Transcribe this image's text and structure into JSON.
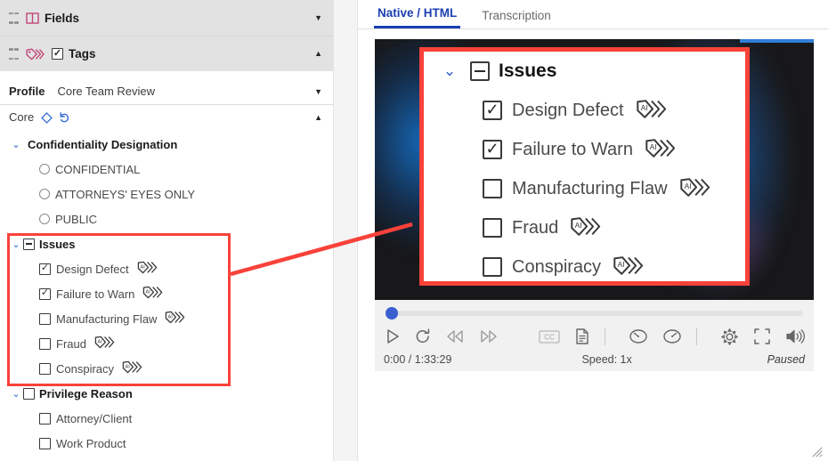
{
  "sidebar": {
    "panels": [
      {
        "label": "Fields",
        "icon": "columns-icon",
        "caret": "▼",
        "expanded": false
      },
      {
        "label": "Tags",
        "icon": "tags-icon",
        "caret": "▲",
        "expanded": true
      }
    ],
    "profile": {
      "label": "Profile",
      "value": "Core Team Review",
      "caret": "▼"
    },
    "core": {
      "label": "Core",
      "caret": "▲",
      "icons": [
        "eraser-icon",
        "undo-icon"
      ]
    },
    "tree": [
      {
        "label": "Confidentiality Designation",
        "type": "node",
        "control": "none",
        "twisty": "⌄"
      },
      {
        "label": "CONFIDENTIAL",
        "type": "leaf",
        "control": "radio",
        "checked": false
      },
      {
        "label": "ATTORNEYS' EYES ONLY",
        "type": "leaf",
        "control": "radio",
        "checked": false
      },
      {
        "label": "PUBLIC",
        "type": "leaf",
        "control": "radio",
        "checked": false
      },
      {
        "label": "Issues",
        "type": "node",
        "control": "minus",
        "twisty": "⌄"
      },
      {
        "label": "Design Defect",
        "type": "leaf",
        "control": "checkbox",
        "checked": true,
        "tag": "ai-tag-icon"
      },
      {
        "label": "Failure to Warn",
        "type": "leaf",
        "control": "checkbox",
        "checked": true,
        "tag": "ai-tag-icon"
      },
      {
        "label": "Manufacturing Flaw",
        "type": "leaf",
        "control": "checkbox",
        "checked": false,
        "tag": "ai-tag-icon"
      },
      {
        "label": "Fraud",
        "type": "leaf",
        "control": "checkbox",
        "checked": false,
        "tag": "ai-tag-icon"
      },
      {
        "label": "Conspiracy",
        "type": "leaf",
        "control": "checkbox",
        "checked": false,
        "tag": "ai-tag-icon"
      },
      {
        "label": "Privilege Reason",
        "type": "node",
        "control": "checkbox",
        "checked": false,
        "twisty": "⌄"
      },
      {
        "label": "Attorney/Client",
        "type": "leaf",
        "control": "checkbox",
        "checked": false
      },
      {
        "label": "Work Product",
        "type": "leaf",
        "control": "checkbox",
        "checked": false
      }
    ]
  },
  "right": {
    "tabs": [
      {
        "label": "Native / HTML",
        "active": true
      },
      {
        "label": "Transcription",
        "active": false
      }
    ],
    "callout": {
      "rows": [
        {
          "label": "Issues",
          "type": "node",
          "control": "minus",
          "twisty": "⌄"
        },
        {
          "label": "Design Defect",
          "type": "leaf",
          "control": "checkbox",
          "checked": true,
          "tag": "ai-tag-icon"
        },
        {
          "label": "Failure to Warn",
          "type": "leaf",
          "control": "checkbox",
          "checked": true,
          "tag": "ai-tag-icon"
        },
        {
          "label": "Manufacturing Flaw",
          "type": "leaf",
          "control": "checkbox",
          "checked": false,
          "tag": "ai-tag-icon"
        },
        {
          "label": "Fraud",
          "type": "leaf",
          "control": "checkbox",
          "checked": false,
          "tag": "ai-tag-icon"
        },
        {
          "label": "Conspiracy",
          "type": "leaf",
          "control": "checkbox",
          "checked": false,
          "tag": "ai-tag-icon"
        }
      ]
    },
    "player": {
      "progress_percent": 0,
      "time": "0:00 / 1:33:29",
      "speed": "Speed: 1x",
      "state": "Paused",
      "left_controls": [
        "play-icon",
        "replay-icon",
        "rewind-icon",
        "fast-forward-icon"
      ],
      "right_controls": [
        "cc-icon",
        "transcript-icon",
        "speed-down-icon",
        "speed-up-icon",
        "settings-icon",
        "fullscreen-icon",
        "volume-icon"
      ]
    }
  },
  "colors": {
    "highlight_red": "#f9423a",
    "accent_blue": "#1a3fb0",
    "tag_pink": "#c04878",
    "twisty_blue": "#2f5fd0"
  }
}
